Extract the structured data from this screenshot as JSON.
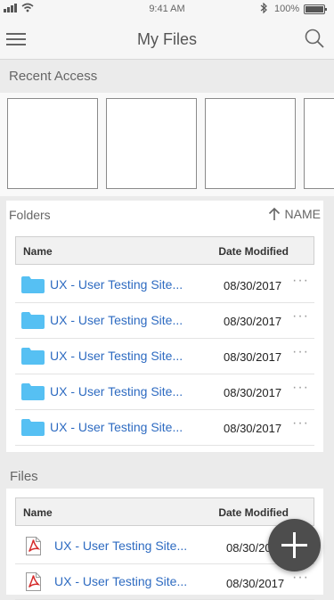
{
  "status_bar": {
    "time": "9:41 AM",
    "battery": "100%"
  },
  "header": {
    "title": "My Files",
    "icons": [
      "menu-icon",
      "search-icon"
    ]
  },
  "recent_access": {
    "label": "Recent Access",
    "card_count": 4
  },
  "folders": {
    "label": "Folders",
    "sort_label": "NAME",
    "columns": {
      "name": "Name",
      "date": "Date Modified"
    },
    "rows": [
      {
        "name": "UX - User Testing Site...",
        "date": "08/30/2017",
        "more": "···"
      },
      {
        "name": "UX - User Testing Site...",
        "date": "08/30/2017",
        "more": "···"
      },
      {
        "name": "UX - User Testing Site...",
        "date": "08/30/2017",
        "more": "···"
      },
      {
        "name": "UX - User Testing Site...",
        "date": "08/30/2017",
        "more": "···"
      },
      {
        "name": "UX - User Testing Site...",
        "date": "08/30/2017",
        "more": "···"
      }
    ]
  },
  "files": {
    "label": "Files",
    "columns": {
      "name": "Name",
      "date": "Date Modified"
    },
    "rows": [
      {
        "name": "UX - User Testing Site...",
        "date": "08/30/2017",
        "more": "···"
      },
      {
        "name": "UX - User Testing Site...",
        "date": "08/30/2017",
        "more": "···"
      }
    ]
  },
  "colors": {
    "link": "#2e6bc1",
    "folder": "#56c0f3",
    "pdf": "#d62b2b",
    "fab": "#4d4d4d"
  }
}
